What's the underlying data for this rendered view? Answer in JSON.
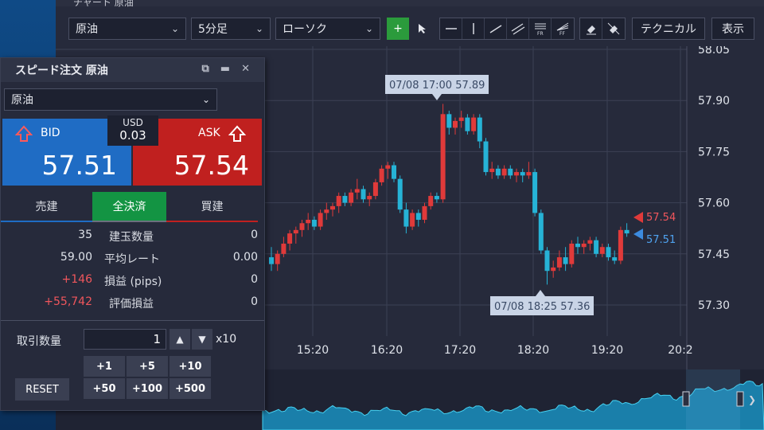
{
  "chart_window": {
    "title": "チャート 原油",
    "toolbar": {
      "symbol": "原油",
      "interval": "5分足",
      "chart_style": "ローソク",
      "technical_label": "テクニカル",
      "display_label": "表示",
      "tools": [
        "crosshair-icon",
        "cursor-icon",
        "hline-icon",
        "vline-icon",
        "trendline-icon",
        "channel-icon",
        "fibo-retracement-icon",
        "fibo-fan-icon",
        "eraser-icon",
        "eraser-all-icon"
      ]
    },
    "x_ticks": [
      "15:20",
      "16:20",
      "17:20",
      "18:20",
      "19:20",
      "20:2"
    ],
    "y_ticks": [
      "58.05",
      "57.90",
      "57.75",
      "57.60",
      "57.45",
      "57.30"
    ],
    "ask_marker": "57.54",
    "bid_marker": "57.51",
    "tooltip_high": "07/08 17:00 57.89",
    "tooltip_low": "07/08 18:25 57.36",
    "colors": {
      "up": "#e03a3a",
      "down": "#26b3d6",
      "bg": "#262a3b",
      "grid": "#3c4155"
    }
  },
  "chart_data": {
    "type": "candlestick",
    "x_ticks": [
      "15:20",
      "16:20",
      "17:20",
      "18:20",
      "19:20",
      "20:2"
    ],
    "y_ticks": [
      58.05,
      57.9,
      57.75,
      57.6,
      57.45,
      57.3
    ],
    "annotations": [
      {
        "label": "07/08 17:00 57.89",
        "value": 57.89
      },
      {
        "label": "07/08 18:25 57.36",
        "value": 57.36
      }
    ],
    "last_ask": 57.54,
    "last_bid": 57.51,
    "candles": [
      [
        57.44,
        57.47,
        57.4,
        57.42
      ],
      [
        57.42,
        57.46,
        57.4,
        57.45
      ],
      [
        57.45,
        57.5,
        57.44,
        57.48
      ],
      [
        57.48,
        57.52,
        57.46,
        57.51
      ],
      [
        57.51,
        57.53,
        57.48,
        57.52
      ],
      [
        57.52,
        57.55,
        57.5,
        57.54
      ],
      [
        57.54,
        57.57,
        57.52,
        57.55
      ],
      [
        57.55,
        57.56,
        57.52,
        57.53
      ],
      [
        57.53,
        57.58,
        57.52,
        57.57
      ],
      [
        57.57,
        57.6,
        57.55,
        57.58
      ],
      [
        57.58,
        57.6,
        57.56,
        57.59
      ],
      [
        57.59,
        57.63,
        57.57,
        57.62
      ],
      [
        57.62,
        57.63,
        57.59,
        57.6
      ],
      [
        57.6,
        57.64,
        57.59,
        57.63
      ],
      [
        57.63,
        57.67,
        57.61,
        57.64
      ],
      [
        57.64,
        57.65,
        57.6,
        57.61
      ],
      [
        57.61,
        57.63,
        57.59,
        57.62
      ],
      [
        57.62,
        57.67,
        57.61,
        57.66
      ],
      [
        57.66,
        57.71,
        57.65,
        57.7
      ],
      [
        57.7,
        57.72,
        57.67,
        57.71
      ],
      [
        57.71,
        57.72,
        57.66,
        57.67
      ],
      [
        57.67,
        57.68,
        57.57,
        57.58
      ],
      [
        57.58,
        57.6,
        57.51,
        57.53
      ],
      [
        57.53,
        57.58,
        57.52,
        57.57
      ],
      [
        57.57,
        57.58,
        57.53,
        57.55
      ],
      [
        57.55,
        57.6,
        57.54,
        57.59
      ],
      [
        57.59,
        57.63,
        57.58,
        57.62
      ],
      [
        57.62,
        57.63,
        57.6,
        57.61
      ],
      [
        57.61,
        57.89,
        57.6,
        57.86
      ],
      [
        57.86,
        57.87,
        57.8,
        57.82
      ],
      [
        57.82,
        57.85,
        57.8,
        57.84
      ],
      [
        57.84,
        57.87,
        57.82,
        57.85
      ],
      [
        57.85,
        57.86,
        57.8,
        57.81
      ],
      [
        57.81,
        57.86,
        57.8,
        57.85
      ],
      [
        57.85,
        57.86,
        57.76,
        57.78
      ],
      [
        57.78,
        57.79,
        57.68,
        57.69
      ],
      [
        57.69,
        57.72,
        57.67,
        57.7
      ],
      [
        57.7,
        57.71,
        57.67,
        57.68
      ],
      [
        57.68,
        57.71,
        57.67,
        57.7
      ],
      [
        57.7,
        57.71,
        57.67,
        57.68
      ],
      [
        57.68,
        57.7,
        57.66,
        57.69
      ],
      [
        57.69,
        57.7,
        57.66,
        57.68
      ],
      [
        57.68,
        57.72,
        57.67,
        57.69
      ],
      [
        57.69,
        57.7,
        57.56,
        57.57
      ],
      [
        57.57,
        57.58,
        57.45,
        57.46
      ],
      [
        57.46,
        57.47,
        57.36,
        57.4
      ],
      [
        57.4,
        57.43,
        57.38,
        57.41
      ],
      [
        57.41,
        57.46,
        57.4,
        57.44
      ],
      [
        57.44,
        57.47,
        57.4,
        57.42
      ],
      [
        57.42,
        57.49,
        57.41,
        57.48
      ],
      [
        57.48,
        57.5,
        57.45,
        57.47
      ],
      [
        57.47,
        57.49,
        57.45,
        57.48
      ],
      [
        57.48,
        57.5,
        57.46,
        57.49
      ],
      [
        57.49,
        57.5,
        57.44,
        57.45
      ],
      [
        57.45,
        57.48,
        57.44,
        57.47
      ],
      [
        57.47,
        57.48,
        57.43,
        57.44
      ],
      [
        57.44,
        57.46,
        57.42,
        57.43
      ],
      [
        57.43,
        57.53,
        57.42,
        57.52
      ],
      [
        57.52,
        57.54,
        57.5,
        57.51
      ]
    ]
  },
  "order_panel": {
    "title": "スピード注文 原油",
    "symbol": "原油",
    "currency": "USD",
    "spread": "0.03",
    "bid_label": "BID",
    "bid_price": "57.51",
    "ask_label": "ASK",
    "ask_price": "57.54",
    "tab_sell": "売建",
    "tab_close_all": "全決済",
    "tab_buy": "買建",
    "rows": [
      {
        "left": "35",
        "label": "建玉数量",
        "right": "0"
      },
      {
        "left": "59.00",
        "label": "平均レート",
        "right": "0.00"
      },
      {
        "left": "+146",
        "label": "損益 (pips)",
        "right": "0"
      },
      {
        "left": "+55,742",
        "label": "評価損益",
        "right": "0"
      }
    ],
    "qty_label": "取引数量",
    "qty_value": "1",
    "multiplier": "x10",
    "quick_buttons": [
      "+1",
      "+5",
      "+10",
      "+50",
      "+100",
      "+500"
    ],
    "reset_label": "RESET"
  }
}
